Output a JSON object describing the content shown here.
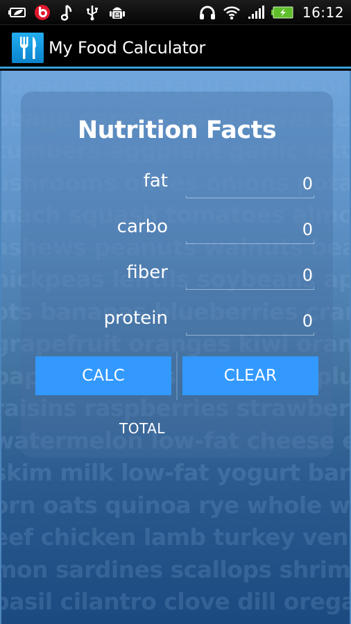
{
  "status_bar": {
    "left_icons": [
      "battery-saver-icon",
      "beats-audio-icon",
      "music-note-icon",
      "usb-icon",
      "android-debug-icon"
    ],
    "right_icons": [
      "headphones-icon",
      "wifi-icon",
      "signal-icon",
      "battery-charging-icon"
    ],
    "time": "16:12",
    "colors": {
      "beats": "#e0182d",
      "battery": "#5fbf2a"
    }
  },
  "action_bar": {
    "app_icon": "fork-knife-icon",
    "title": "My Food Calculator",
    "accent": "#3aa0d8"
  },
  "background_words": [
    "vocados asparagus beets brocco",
    "bbage carrots cauliflower cele",
    "cumbers eggplant garlic lettu",
    "ushrooms olives onions potato",
    "inach squash tomatoes almon",
    "ashews peanuts walnuts bean",
    "hickpeas lentils soybeans apple",
    "ots bananas blueberries cranb",
    "grapefruit oranges kiwi orange",
    "papayas pears pineapple plums",
    "raisins raspberries strawberries",
    "watermelon low-fat cheese egg",
    "skim milk low-fat yogurt barley",
    "orn oats quinoa rye whole whe",
    "eef chicken lamb turkey veniso",
    "mon sardines scallops shrimp t",
    "basil cilantro clove dill oregano"
  ],
  "card": {
    "title": "Nutrition Facts",
    "fields": [
      {
        "label": "fat",
        "value": "0"
      },
      {
        "label": "carbo",
        "value": "0"
      },
      {
        "label": "fiber",
        "value": "0"
      },
      {
        "label": "protein",
        "value": "0"
      }
    ],
    "calc_label": "CALC",
    "clear_label": "CLEAR",
    "total_label": "TOTAL",
    "button_color": "#3399ff"
  }
}
